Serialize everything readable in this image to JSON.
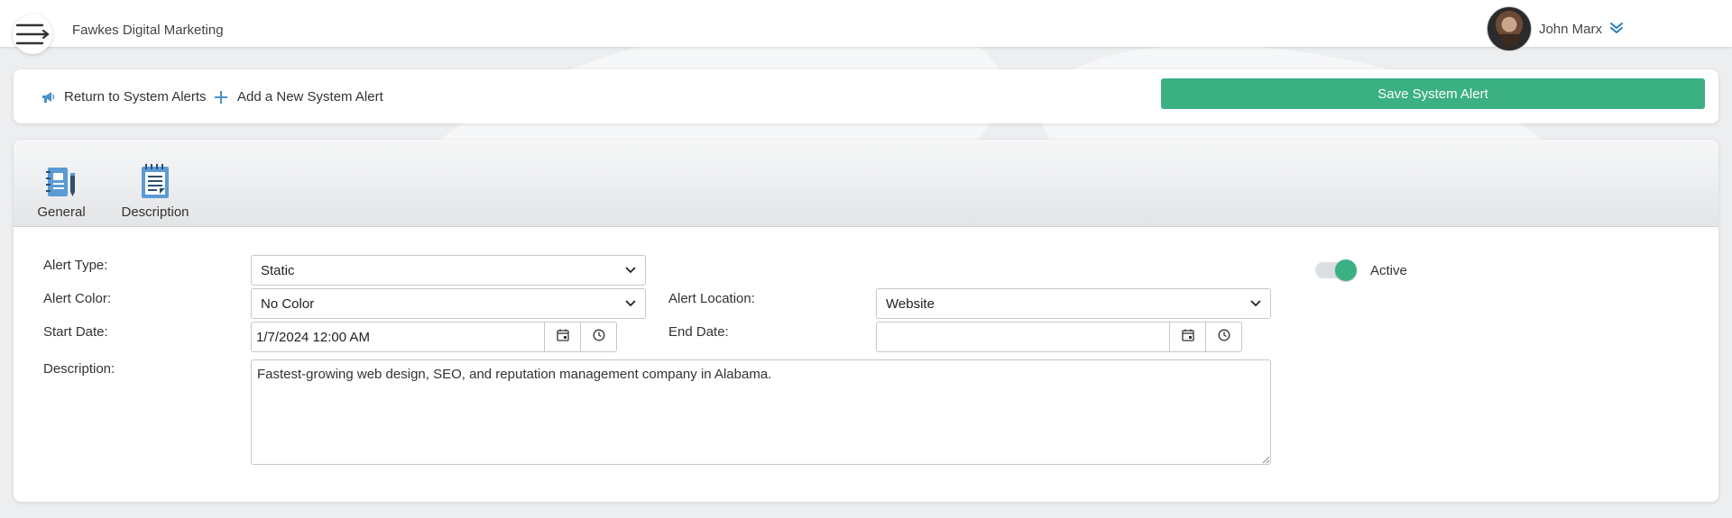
{
  "header": {
    "company_name": "Fawkes Digital Marketing",
    "user_name": "John Marx"
  },
  "actions": {
    "return_label": "Return to System Alerts",
    "add_label": "Add a New System Alert",
    "save_label": "Save System Alert"
  },
  "tabs": [
    {
      "label": "General",
      "icon": "notebook-pen-icon"
    },
    {
      "label": "Description",
      "icon": "notepad-icon"
    }
  ],
  "form": {
    "alert_type": {
      "label": "Alert Type:",
      "value": "Static"
    },
    "alert_color": {
      "label": "Alert Color:",
      "value": "No Color"
    },
    "alert_location": {
      "label": "Alert Location:",
      "value": "Website"
    },
    "start_date": {
      "label": "Start Date:",
      "value": "1/7/2024 12:00 AM"
    },
    "end_date": {
      "label": "End Date:",
      "value": ""
    },
    "description": {
      "label": "Description:",
      "value": "Fastest-growing web design, SEO, and reputation management company in Alabama."
    },
    "active": {
      "label": "Active",
      "on": true
    }
  },
  "colors": {
    "accent": "#3bb083"
  }
}
